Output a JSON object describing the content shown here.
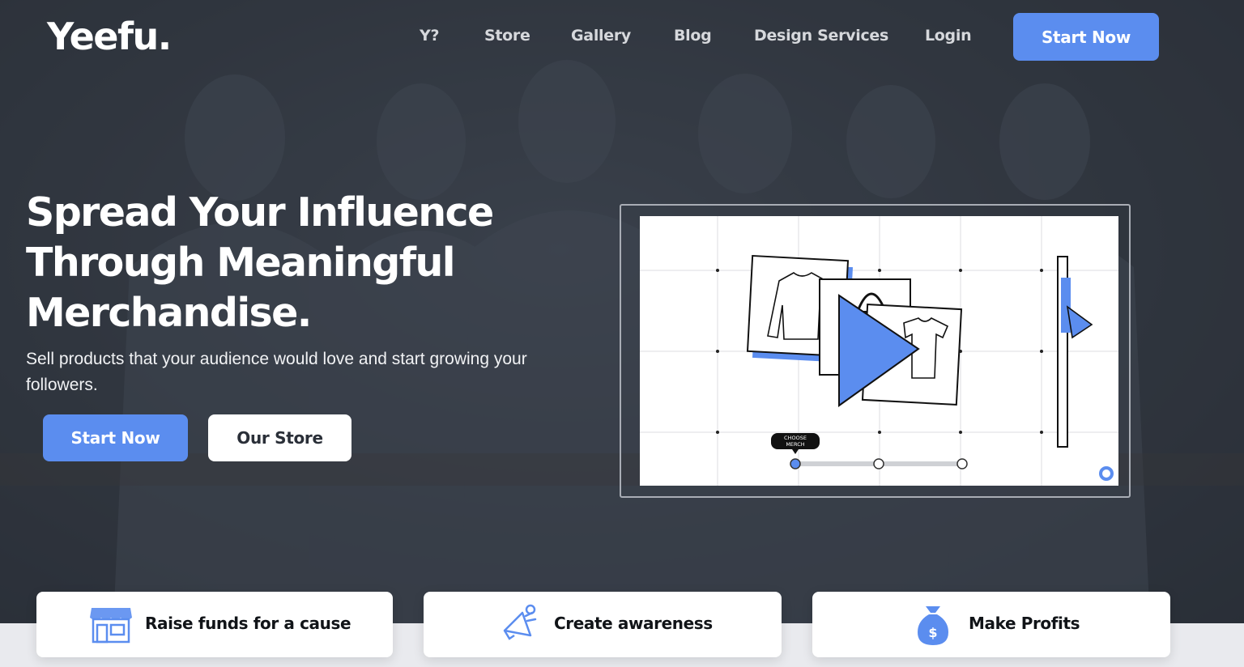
{
  "brand": {
    "logo": "Yeefu."
  },
  "nav": {
    "links": [
      "Y?",
      "Store",
      "Gallery",
      "Blog",
      "Design Services",
      "Login"
    ],
    "cta": "Start Now"
  },
  "hero": {
    "headline_lines": [
      "Spread Your Influence",
      "Through Meaningful",
      "Merchandise."
    ],
    "subtext": "Sell products that your audience would love and start growing your followers.",
    "primary_button": "Start Now",
    "secondary_button": "Our Store"
  },
  "video": {
    "tooltip": [
      "CHOOSE",
      "MERCH"
    ]
  },
  "features": [
    {
      "label": "Raise funds for a cause",
      "icon": "storefront-icon"
    },
    {
      "label": "Create awareness",
      "icon": "megaphone-icon"
    },
    {
      "label": "Make Profits",
      "icon": "money-bag-icon"
    }
  ],
  "colors": {
    "accent": "#5b8def",
    "hero_bg": "#3a4049",
    "card_bg": "#ffffff"
  }
}
